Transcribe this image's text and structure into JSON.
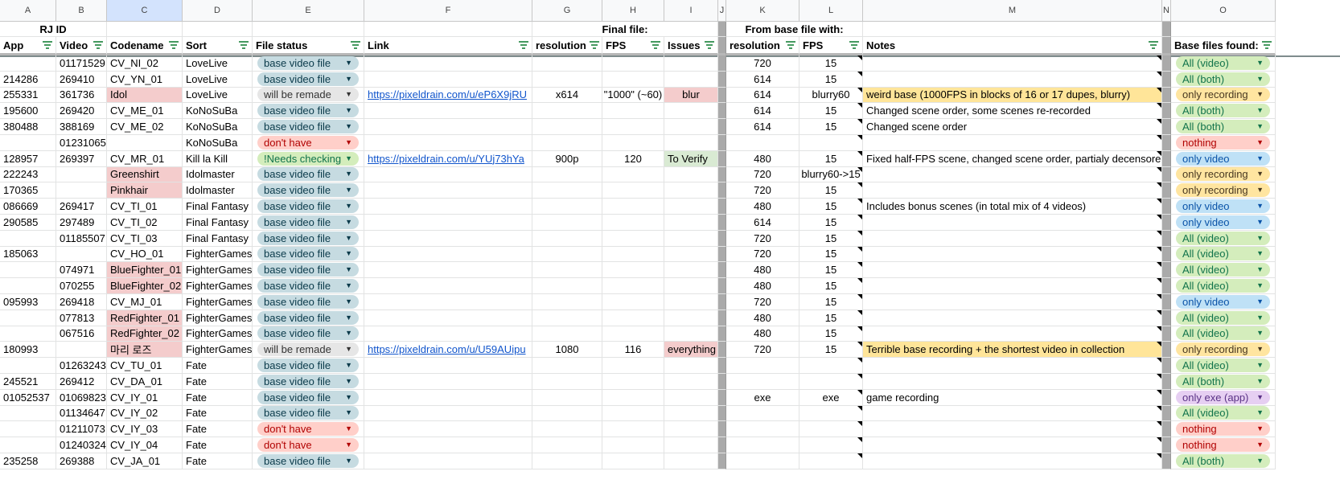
{
  "column_letters": [
    "A",
    "B",
    "C",
    "D",
    "E",
    "F",
    "G",
    "H",
    "I",
    "J",
    "K",
    "L",
    "M",
    "N",
    "O"
  ],
  "group_headers": {
    "rj_id": "RJ ID",
    "final_file": "Final file:",
    "from_base": "From base file with:"
  },
  "headers": {
    "app": "App",
    "video": "Video",
    "codename": "Codename",
    "sort": "Sort",
    "file_status": "File status",
    "link": "Link",
    "resolution": "resolution",
    "fps": "FPS",
    "issues": "Issues",
    "base_resolution": "resolution",
    "base_fps": "FPS",
    "notes": "Notes",
    "base_found": "Base files found:"
  },
  "colors": {
    "header_bg": "#f8f9fa",
    "selected_col": "#d3e3fd",
    "pink": "#f4cccc",
    "green": "#d9ead3",
    "yellow": "#ffe599",
    "link": "#1155cc"
  },
  "rows": [
    {
      "app": "",
      "video": "01171529",
      "codename": "CV_NI_02",
      "sort": "LoveLive",
      "status": "base video file",
      "link": "",
      "res": "",
      "fps": "",
      "issues": "",
      "bres": "720",
      "bfps": "15",
      "notes": "",
      "found": "All (video)"
    },
    {
      "app": "214286",
      "video": "269410",
      "codename": "CV_YN_01",
      "sort": "LoveLive",
      "status": "base video file",
      "link": "",
      "res": "",
      "fps": "",
      "issues": "",
      "bres": "614",
      "bfps": "15",
      "notes": "",
      "found": "All (both)"
    },
    {
      "app": "255331",
      "video": "361736",
      "codename": "Idol",
      "sort": "LoveLive",
      "status": "will be remade",
      "link": "https://pixeldrain.com/u/eP6X9jRU",
      "res": "x614",
      "fps": "\"1000\" (~60)",
      "issues": "blur",
      "bres": "614",
      "bfps": "blurry60",
      "notes": "weird base (1000FPS in blocks of 16 or 17 dupes, blurry)",
      "found": "only recording"
    },
    {
      "app": "195600",
      "video": "269420",
      "codename": "CV_ME_01",
      "sort": "KoNoSuBa",
      "status": "base video file",
      "link": "",
      "res": "",
      "fps": "",
      "issues": "",
      "bres": "614",
      "bfps": "15",
      "notes": "Changed scene order, some scenes re-recorded",
      "found": "All (both)"
    },
    {
      "app": "380488",
      "video": "388169",
      "codename": "CV_ME_02",
      "sort": "KoNoSuBa",
      "status": "base video file",
      "link": "",
      "res": "",
      "fps": "",
      "issues": "",
      "bres": "614",
      "bfps": "15",
      "notes": "Changed scene order",
      "found": "All (both)"
    },
    {
      "app": "",
      "video": "01231065",
      "codename": "",
      "sort": "KoNoSuBa",
      "status": "don't have",
      "link": "",
      "res": "",
      "fps": "",
      "issues": "",
      "bres": "",
      "bfps": "",
      "notes": "",
      "found": "nothing"
    },
    {
      "app": "128957",
      "video": "269397",
      "codename": "CV_MR_01",
      "sort": "Kill la Kill",
      "status": "!Needs checking",
      "link": "https://pixeldrain.com/u/YUj73hYa",
      "res": "900p",
      "fps": "120",
      "issues": "To Verify",
      "bres": "480",
      "bfps": "15",
      "notes": "Fixed half-FPS scene, changed scene order, partialy decensored",
      "found": "only video"
    },
    {
      "app": "222243",
      "video": "",
      "codename": "Greenshirt",
      "sort": "Idolmaster",
      "status": "base video file",
      "link": "",
      "res": "",
      "fps": "",
      "issues": "",
      "bres": "720",
      "bfps": "blurry60->15",
      "notes": "",
      "found": "only recording"
    },
    {
      "app": "170365",
      "video": "",
      "codename": "Pinkhair",
      "sort": "Idolmaster",
      "status": "base video file",
      "link": "",
      "res": "",
      "fps": "",
      "issues": "",
      "bres": "720",
      "bfps": "15",
      "notes": "",
      "found": "only recording"
    },
    {
      "app": "086669",
      "video": "269417",
      "codename": "CV_TI_01",
      "sort": "Final Fantasy",
      "status": "base video file",
      "link": "",
      "res": "",
      "fps": "",
      "issues": "",
      "bres": "480",
      "bfps": "15",
      "notes": "Includes bonus scenes (in total mix of 4 videos)",
      "found": "only video"
    },
    {
      "app": "290585",
      "video": "297489",
      "codename": "CV_TI_02",
      "sort": "Final Fantasy",
      "status": "base video file",
      "link": "",
      "res": "",
      "fps": "",
      "issues": "",
      "bres": "614",
      "bfps": "15",
      "notes": "",
      "found": "only video"
    },
    {
      "app": "",
      "video": "01185507",
      "codename": "CV_TI_03",
      "sort": "Final Fantasy",
      "status": "base video file",
      "link": "",
      "res": "",
      "fps": "",
      "issues": "",
      "bres": "720",
      "bfps": "15",
      "notes": "",
      "found": "All (video)"
    },
    {
      "app": "185063",
      "video": "",
      "codename": "CV_HO_01",
      "sort": "FighterGames",
      "status": "base video file",
      "link": "",
      "res": "",
      "fps": "",
      "issues": "",
      "bres": "720",
      "bfps": "15",
      "notes": "",
      "found": "All (video)"
    },
    {
      "app": "",
      "video": "074971",
      "codename": "BlueFighter_01",
      "sort": "FighterGames",
      "status": "base video file",
      "link": "",
      "res": "",
      "fps": "",
      "issues": "",
      "bres": "480",
      "bfps": "15",
      "notes": "",
      "found": "All (video)"
    },
    {
      "app": "",
      "video": "070255",
      "codename": "BlueFighter_02",
      "sort": "FighterGames",
      "status": "base video file",
      "link": "",
      "res": "",
      "fps": "",
      "issues": "",
      "bres": "480",
      "bfps": "15",
      "notes": "",
      "found": "All (video)"
    },
    {
      "app": "095993",
      "video": "269418",
      "codename": "CV_MJ_01",
      "sort": "FighterGames",
      "status": "base video file",
      "link": "",
      "res": "",
      "fps": "",
      "issues": "",
      "bres": "720",
      "bfps": "15",
      "notes": "",
      "found": "only video"
    },
    {
      "app": "",
      "video": "077813",
      "codename": "RedFighter_01",
      "sort": "FighterGames",
      "status": "base video file",
      "link": "",
      "res": "",
      "fps": "",
      "issues": "",
      "bres": "480",
      "bfps": "15",
      "notes": "",
      "found": "All (video)"
    },
    {
      "app": "",
      "video": "067516",
      "codename": "RedFighter_02",
      "sort": "FighterGames",
      "status": "base video file",
      "link": "",
      "res": "",
      "fps": "",
      "issues": "",
      "bres": "480",
      "bfps": "15",
      "notes": "",
      "found": "All (video)"
    },
    {
      "app": "180993",
      "video": "",
      "codename": "마리 로즈",
      "sort": "FighterGames",
      "status": "will be remade",
      "link": "https://pixeldrain.com/u/U59AUipu",
      "res": "1080",
      "fps": "116",
      "issues": "everything",
      "bres": "720",
      "bfps": "15",
      "notes": "Terrible base recording + the shortest video in collection",
      "found": "only recording"
    },
    {
      "app": "",
      "video": "01263243",
      "codename": "CV_TU_01",
      "sort": "Fate",
      "status": "base video file",
      "link": "",
      "res": "",
      "fps": "",
      "issues": "",
      "bres": "",
      "bfps": "",
      "notes": "",
      "found": "All (video)"
    },
    {
      "app": "245521",
      "video": "269412",
      "codename": "CV_DA_01",
      "sort": "Fate",
      "status": "base video file",
      "link": "",
      "res": "",
      "fps": "",
      "issues": "",
      "bres": "",
      "bfps": "",
      "notes": "",
      "found": "All (both)"
    },
    {
      "app": "01052537",
      "video": "01069823",
      "codename": "CV_IY_01",
      "sort": "Fate",
      "status": "base video file",
      "link": "",
      "res": "",
      "fps": "",
      "issues": "",
      "bres": "exe",
      "bfps": "exe",
      "notes": "game recording",
      "found": "only exe (app)"
    },
    {
      "app": "",
      "video": "01134647",
      "codename": "CV_IY_02",
      "sort": "Fate",
      "status": "base video file",
      "link": "",
      "res": "",
      "fps": "",
      "issues": "",
      "bres": "",
      "bfps": "",
      "notes": "",
      "found": "All (video)"
    },
    {
      "app": "",
      "video": "01211073",
      "codename": "CV_IY_03",
      "sort": "Fate",
      "status": "don't have",
      "link": "",
      "res": "",
      "fps": "",
      "issues": "",
      "bres": "",
      "bfps": "",
      "notes": "",
      "found": "nothing"
    },
    {
      "app": "",
      "video": "01240324",
      "codename": "CV_IY_04",
      "sort": "Fate",
      "status": "don't have",
      "link": "",
      "res": "",
      "fps": "",
      "issues": "",
      "bres": "",
      "bfps": "",
      "notes": "",
      "found": "nothing"
    },
    {
      "app": "235258",
      "video": "269388",
      "codename": "CV_JA_01",
      "sort": "Fate",
      "status": "base video file",
      "link": "",
      "res": "",
      "fps": "",
      "issues": "",
      "bres": "",
      "bfps": "",
      "notes": "",
      "found": "All (both)"
    }
  ]
}
